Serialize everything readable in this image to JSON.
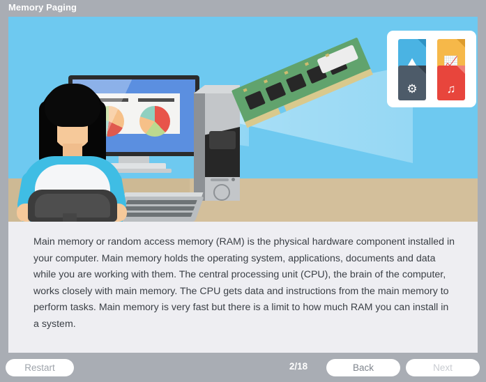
{
  "window": {
    "title": "Memory Paging"
  },
  "illustration": {
    "alt_name": "ram-memory-illustration",
    "colors": {
      "sky": "#6ec9f0",
      "floor": "#d3bf9b",
      "ram_board": "#3f8f4e",
      "ram_contacts": "#d9c98d",
      "beam": "#ffffff",
      "shirt": "#3fbde4",
      "hair": "#060606",
      "monitor_screen": "#5b8fe0",
      "tower": "#c3c6c9"
    },
    "monitor": {
      "document_name": "chart-document",
      "charts": [
        {
          "name": "pie-chart-left",
          "slices": [
            "#f6c088",
            "#e05a4f",
            "#8fd0c0",
            "#bcd98f"
          ]
        },
        {
          "name": "pie-chart-right",
          "slices": [
            "#e8544a",
            "#bcd98f",
            "#f6c088",
            "#8fd0c0"
          ]
        }
      ]
    },
    "file_card": {
      "name": "file-type-card",
      "files": [
        {
          "name": "image-file-icon",
          "glyph": "ὛB",
          "symbol": "⛰",
          "color": "#4ab3e3"
        },
        {
          "name": "chart-file-icon",
          "glyph": "bars",
          "symbol": "▐",
          "color": "#f6b849"
        },
        {
          "name": "settings-file-icon",
          "glyph": "gear",
          "symbol": "⚙",
          "color": "#4d5b69"
        },
        {
          "name": "music-file-icon",
          "glyph": "note",
          "symbol": "♫",
          "color": "#e8453c"
        }
      ]
    }
  },
  "content": {
    "paragraph": "Main memory or random access memory (RAM) is the physical hardware component installed in your computer. Main memory holds the operating system, applications, documents and data while you are working with them. The central processing unit (CPU), the brain of the computer, works closely with main memory. The CPU gets data and instructions from the main memory to perform tasks. Main memory is very fast but there is a limit to how much RAM you can install in a system."
  },
  "footer": {
    "restart_label": "Restart",
    "counter": "2/18",
    "back_label": "Back",
    "next_label": "Next",
    "next_disabled": true
  }
}
